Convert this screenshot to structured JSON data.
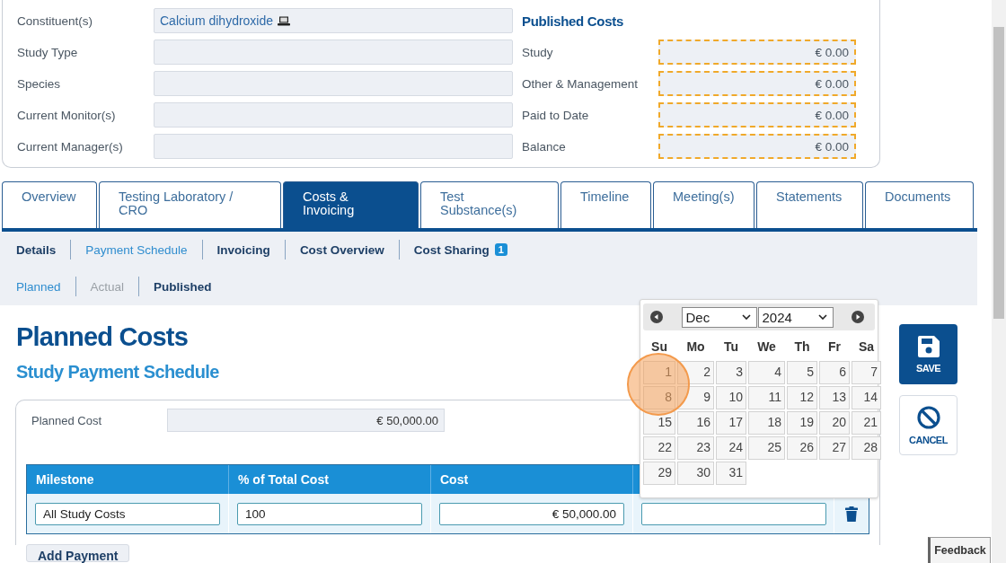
{
  "details": {
    "fields": [
      {
        "label": "Constituent(s)",
        "value": "Calcium dihydroxide",
        "kind": "link"
      },
      {
        "label": "Study Type",
        "kind": "empty"
      },
      {
        "label": "Species",
        "kind": "empty"
      },
      {
        "label": "Current Monitor(s)",
        "kind": "empty"
      },
      {
        "label": "Current Manager(s)",
        "kind": "empty"
      }
    ],
    "published_costs": {
      "title": "Published Costs",
      "rows": [
        {
          "label": "Study",
          "value": "€ 0.00"
        },
        {
          "label": "Other & Management",
          "value": "€ 0.00"
        },
        {
          "label": "Paid to Date",
          "value": "€ 0.00"
        },
        {
          "label": "Balance",
          "value": "€ 0.00"
        }
      ]
    }
  },
  "tabs": [
    {
      "label": "Overview",
      "selected": false
    },
    {
      "label": "Testing Laboratory / CRO",
      "selected": false
    },
    {
      "label": "Costs & Invoicing",
      "selected": true
    },
    {
      "label": "Test Substance(s)",
      "selected": false
    },
    {
      "label": "Timeline",
      "selected": false
    },
    {
      "label": "Meeting(s)",
      "selected": false
    },
    {
      "label": "Statements",
      "selected": false
    },
    {
      "label": "Documents",
      "selected": false
    }
  ],
  "subnav": [
    {
      "label": "Details",
      "selected": false
    },
    {
      "label": "Payment Schedule",
      "selected": true
    },
    {
      "label": "Invoicing",
      "selected": false
    },
    {
      "label": "Cost Overview",
      "selected": false
    },
    {
      "label": "Cost Sharing",
      "selected": false,
      "badge": "1"
    }
  ],
  "cost_tabs": [
    {
      "label": "Planned",
      "selected": true,
      "disabled": false
    },
    {
      "label": "Actual",
      "selected": false,
      "disabled": true
    },
    {
      "label": "Published",
      "selected": false,
      "disabled": false
    }
  ],
  "title": "Planned Costs",
  "subtitle": "Study Payment Schedule",
  "planned_cost": {
    "label": "Planned Cost",
    "value": "€ 50,000.00"
  },
  "table": {
    "columns": [
      "Milestone",
      "% of Total Cost",
      "Cost"
    ],
    "rows": [
      {
        "milestone": "All Study Costs",
        "percent": "100",
        "cost": "€ 50,000.00"
      }
    ]
  },
  "add_button": "Add Payment",
  "calendar": {
    "month": "Dec",
    "year": "2024",
    "weekdays": [
      "Su",
      "Mo",
      "Tu",
      "We",
      "Th",
      "Fr",
      "Sa"
    ],
    "days": [
      "1",
      "2",
      "3",
      "4",
      "5",
      "6",
      "7",
      "8",
      "9",
      "10",
      "11",
      "12",
      "13",
      "14",
      "15",
      "16",
      "17",
      "18",
      "19",
      "20",
      "21",
      "22",
      "23",
      "24",
      "25",
      "26",
      "27",
      "28",
      "29",
      "30",
      "31"
    ]
  },
  "actions": [
    {
      "label": "SAVE",
      "kind": "save"
    },
    {
      "label": "CANCEL",
      "kind": "cancel"
    }
  ],
  "feedback": "Feedback"
}
